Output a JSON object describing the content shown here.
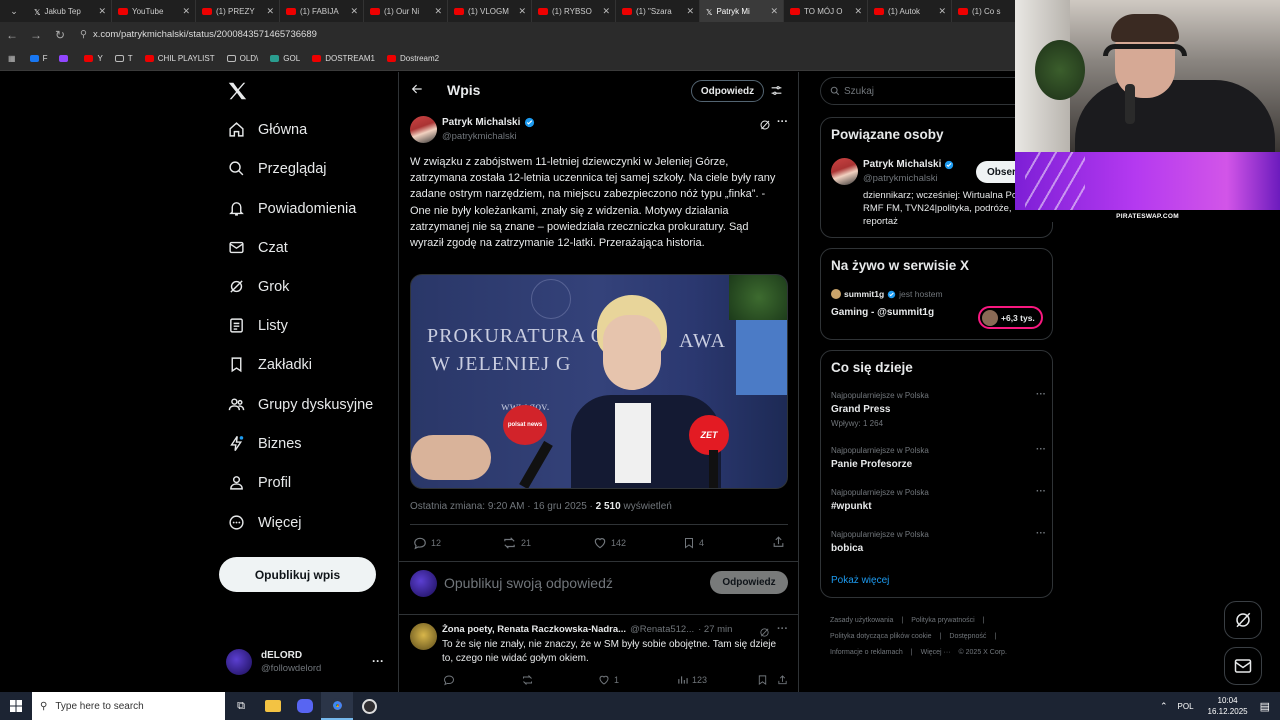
{
  "browser": {
    "tabs": [
      {
        "label": "Jakub Tep",
        "icon": "x"
      },
      {
        "label": "YouTube",
        "icon": "yt"
      },
      {
        "label": "(1) PREZY",
        "icon": "yt"
      },
      {
        "label": "(1) FABIJA",
        "icon": "yt"
      },
      {
        "label": "(1) Our Ni",
        "icon": "yt"
      },
      {
        "label": "(1) VLOGM",
        "icon": "yt"
      },
      {
        "label": "(1) RYBSO",
        "icon": "yt"
      },
      {
        "label": "(1) \"Szara",
        "icon": "yt"
      },
      {
        "label": "Patryk Mi",
        "icon": "x",
        "active": true
      },
      {
        "label": "TO MÓJ O",
        "icon": "yt"
      },
      {
        "label": "(1) Autok",
        "icon": "yt"
      },
      {
        "label": "(1) Co s",
        "icon": "yt"
      }
    ],
    "url": "x.com/patrykmichalski/status/2000843571465736689",
    "bookmarks": [
      "F",
      "",
      "Y",
      "T",
      "CHIL PLAYLIST",
      "OLD\\",
      "GOL",
      "DOSTREAM1",
      "Dostream2"
    ]
  },
  "sidebar": {
    "items": [
      {
        "label": "Główna",
        "icon": "home-icon"
      },
      {
        "label": "Przeglądaj",
        "icon": "search-icon"
      },
      {
        "label": "Powiadomienia",
        "icon": "bell-icon"
      },
      {
        "label": "Czat",
        "icon": "mail-icon"
      },
      {
        "label": "Grok",
        "icon": "grok-icon"
      },
      {
        "label": "Listy",
        "icon": "list-icon"
      },
      {
        "label": "Zakładki",
        "icon": "bookmark-icon"
      },
      {
        "label": "Grupy dyskusyjne",
        "icon": "people-icon"
      },
      {
        "label": "Biznes",
        "icon": "lightning-icon"
      },
      {
        "label": "Profil",
        "icon": "person-icon"
      },
      {
        "label": "Więcej",
        "icon": "more-circle-icon"
      }
    ],
    "post_button": "Opublikuj wpis",
    "account": {
      "name": "dELORD",
      "handle": "@followdelord"
    }
  },
  "header": {
    "title": "Wpis",
    "reply_button": "Odpowiedz"
  },
  "post": {
    "author": "Patryk Michalski",
    "handle": "@patrykmichalski",
    "text": "W związku z zabójstwem 11-letniej dziewczynki w Jeleniej Górze, zatrzymana została 12-letnia uczennica tej samej szkoły. Na ciele były rany zadane ostrym narzędziem, na miejscu zabezpieczono nóż typu „finka”. - One nie były koleżankami, znały się z widzenia. Motywy działania zatrzymanej nie są znane – powiedziała rzeczniczka prokuratury. Sąd wyraził zgodę na zatrzymanie 12-latki. Przerażająca historia.",
    "image_text_line1": "PROKURATURA O",
    "image_text_line2": "W JELENIEJ G",
    "image_text_right": "AWA",
    "image_text_web": "www.gov.",
    "image_mic1": "polsat news",
    "image_mic2": "ZET",
    "meta_prefix": "Ostatnia zmiana: 9:20 AM · 16 gru 2025 · ",
    "views": "2 510",
    "views_label": " wyświetleń",
    "stats": {
      "replies": "12",
      "reposts": "21",
      "likes": "142",
      "bookmarks": "4"
    }
  },
  "compose": {
    "placeholder": "Opublikuj swoją odpowiedź",
    "button": "Odpowiedz"
  },
  "reply": {
    "author": "Żona poety, Renata Raczkowska-Nadra...",
    "handle": "@Renata512...",
    "time": "· 27 min",
    "text": "To że się nie znały, nie znaczy, że w SM były sobie obojętne. Tam się dzieje to, czego nie widać gołym okiem.",
    "stats": {
      "replies": "",
      "reposts": "",
      "likes": "1",
      "views": "123"
    }
  },
  "right": {
    "search_placeholder": "Szukaj",
    "related": {
      "title": "Powiązane osoby",
      "name": "Patryk Michalski",
      "handle": "@patrykmichalski",
      "follow": "Obser",
      "bio": "dziennikarz; wcześniej: Wirtualna Polska, RMF FM, TVN24|polityka, podróże, reportaż"
    },
    "live": {
      "title": "Na żywo w serwisie X",
      "host": "summit1g",
      "host_suffix": "jest hostem",
      "name": "Gaming - @summit1g",
      "count": "+6,3 tys."
    },
    "trends": {
      "title": "Co się dzieje",
      "items": [
        {
          "meta": "Najpopularniejsze w Polska",
          "name": "Grand Press",
          "extra": "Wpływy: 1 264"
        },
        {
          "meta": "Najpopularniejsze w Polska",
          "name": "Panie Profesorze",
          "extra": ""
        },
        {
          "meta": "Najpopularniejsze w Polska",
          "name": "#wpunkt",
          "extra": ""
        },
        {
          "meta": "Najpopularniejsze w Polska",
          "name": "bobica",
          "extra": ""
        }
      ],
      "more": "Pokaż więcej"
    },
    "footer": {
      "l1": "Zasady użytkowania",
      "l2": "Polityka prywatności",
      "l3": "Polityka dotycząca plików cookie",
      "l4": "Dostępność",
      "l5": "Informacje o reklamach",
      "l6": "Więcej ···",
      "l7": "© 2025 X Corp."
    }
  },
  "overlay": {
    "banner": "PIRATESWAP.COM"
  },
  "taskbar": {
    "search_placeholder": "Type here to search",
    "lang": "POL",
    "time": "10:04",
    "date": "16.12.2025"
  },
  "colors": {
    "accent": "#1d9bf0",
    "background": "#000000",
    "border": "#2f3336",
    "muted": "#71767b",
    "live": "#f91880"
  }
}
